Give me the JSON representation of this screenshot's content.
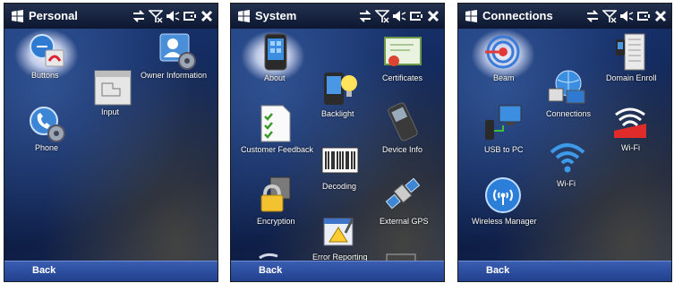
{
  "screens": [
    {
      "title": "Personal",
      "items": [
        "Buttons",
        "Owner Information",
        "Input",
        "Phone"
      ],
      "softkey": "Back"
    },
    {
      "title": "System",
      "items": [
        "About",
        "Certificates",
        "Backlight",
        "Customer Feedback",
        "Device Info",
        "Decoding",
        "Encryption",
        "External GPS",
        "Error Reporting"
      ],
      "softkey": "Back"
    },
    {
      "title": "Connections",
      "items": [
        "Beam",
        "Domain Enroll",
        "Connections",
        "USB to PC",
        "Wi-Fi",
        "Wi-Fi",
        "Wireless Manager"
      ],
      "softkey": "Back"
    }
  ],
  "status_icons": [
    "connectivity-icon",
    "no-signal-icon",
    "speaker-icon",
    "battery-icon",
    "close-icon"
  ]
}
